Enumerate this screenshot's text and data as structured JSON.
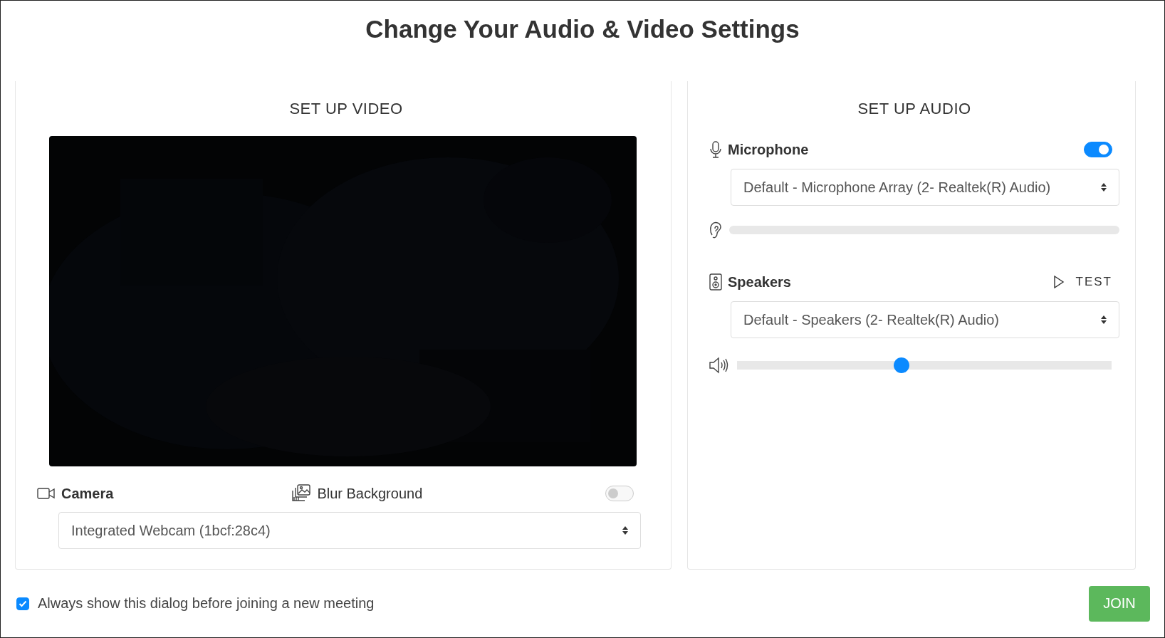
{
  "title": "Change Your Audio & Video Settings",
  "video": {
    "heading": "SET UP VIDEO",
    "camera": {
      "label": "Camera",
      "device": "Integrated Webcam (1bcf:28c4)"
    },
    "blur": {
      "label": "Blur Background",
      "on": false
    }
  },
  "audio": {
    "heading": "SET UP AUDIO",
    "microphone": {
      "label": "Microphone",
      "on": true,
      "device": "Default - Microphone Array (2- Realtek(R) Audio)"
    },
    "speakers": {
      "label": "Speakers",
      "test": "TEST",
      "device": "Default - Speakers (2- Realtek(R) Audio)",
      "level": 0.44
    }
  },
  "footer": {
    "always_show": {
      "label": "Always show this dialog before joining a new meeting",
      "checked": true
    },
    "join": "JOIN"
  }
}
